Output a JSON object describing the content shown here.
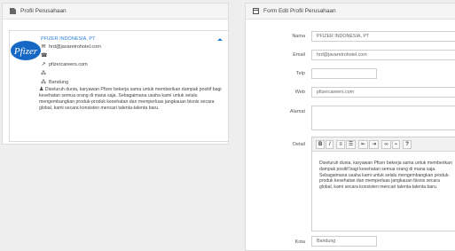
{
  "profile_panel": {
    "title": "Profil Perusahaan",
    "logo_text": "Pfizer",
    "company_name": "PFIZER INDONESIA, PT",
    "email": "hrd@javaretrohotel.com",
    "phone": "",
    "website": "pfizercareers.com",
    "address": "",
    "city": "Bandung",
    "description": "Diseluruh dunia, karyawan Pfizer bekerja sama untuk memberikan dampak positif bagi kesehatan semua orang di mana saja. Sebagaimana usaha kami untuk selalu mengembangkan produk-produk kesehatan dan memperluas jangkauan bisnis secara global, kami secara konsisten mencari talenta-talenta baru."
  },
  "edit_panel": {
    "title": "Form Edit Profil Perusahaan",
    "labels": {
      "nama": "Nama",
      "email": "Email",
      "telp": "Telp",
      "web": "Web",
      "alamat": "Alamat",
      "detail": "Detail",
      "kota": "Kota"
    },
    "values": {
      "nama": "PFIZER INDONESIA, PT",
      "email": "hrd@javaretrohotel.com",
      "telp": "",
      "web": "pfizercareers.com",
      "alamat": "",
      "kota": "Bandung"
    },
    "toolbar": {
      "bold": "B",
      "italic": "I",
      "help": "?"
    },
    "detail_text": "Diseluruh dunia, karyawan Pfizer bekerja sama untuk memberikan dampak positif bagi kesehatan semua orang di mana saja. Sebagaimana usaha kami untuk selalu mengembangkan produk-produk kesehatan dan memperluas jangkauan bisnis secara global, kami secara konsisten mencari talenta-talenta baru."
  },
  "colors": {
    "accent": "#2a7fd4",
    "logo": "#1768c4"
  }
}
